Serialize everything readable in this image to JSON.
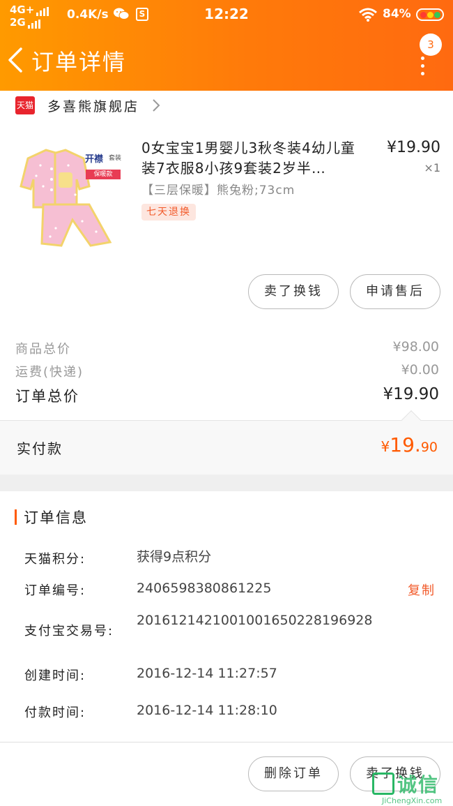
{
  "status_bar": {
    "network_top": "4G+",
    "network_bottom": "2G",
    "speed": "0.4K/s",
    "s_icon_letter": "S",
    "time": "12:22",
    "battery_pct": "84%"
  },
  "nav": {
    "title": "订单详情",
    "badge_count": "3"
  },
  "store": {
    "badge": "天猫",
    "name": "多喜熊旗舰店"
  },
  "product": {
    "title": "0女宝宝1男婴儿3秋冬装4幼儿童装7衣服8小孩9套装2岁半…",
    "price": "¥19.90",
    "quantity": "×1",
    "sku": "【三层保暖】熊兔粉;73cm",
    "return_tag": "七天退换",
    "image_label_1": "开襟",
    "image_label_2": "套装",
    "image_label_3": "保暖款",
    "sell_button": "卖了换钱",
    "aftersale_button": "申请售后"
  },
  "summary": {
    "goods_label": "商品总价",
    "goods_value": "¥98.00",
    "shipping_label": "运费(快递)",
    "shipping_value": "¥0.00",
    "total_label": "订单总价",
    "total_value": "¥19.90",
    "paid_label": "实付款",
    "paid_currency": "¥",
    "paid_int": "19.",
    "paid_dec": "90"
  },
  "order_info": {
    "title": "订单信息",
    "rows": [
      {
        "label": "天猫积分:",
        "value": "获得9点积分"
      },
      {
        "label": "订单编号:",
        "value": "2406598380861225",
        "action": "复制"
      },
      {
        "label": "支付宝交易号:",
        "value": "2016121421001001650228196928"
      },
      {
        "label": "创建时间:",
        "value": "2016-12-14 11:27:57"
      },
      {
        "label": "付款时间:",
        "value": "2016-12-14 11:28:10"
      }
    ]
  },
  "bottom_bar": {
    "delete_button": "删除订单",
    "sell_button": "卖了换钱"
  },
  "watermark": {
    "cn": "诚信",
    "en": "JiChengXin.com"
  },
  "colors": {
    "header_start": "#ff9a00",
    "header_end": "#ff6a10",
    "accent": "#ff5a00",
    "tmall_red": "#e8242d"
  }
}
